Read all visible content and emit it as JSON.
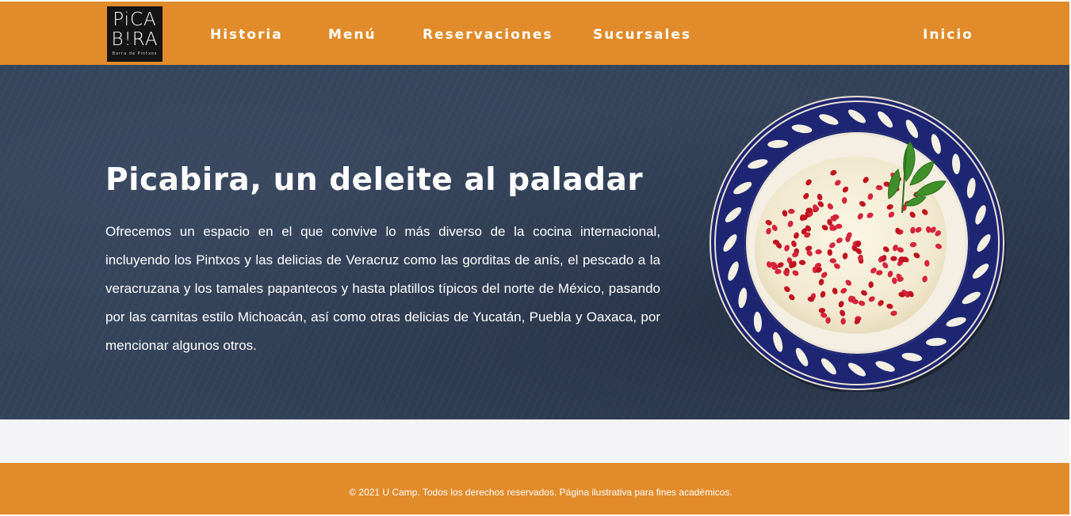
{
  "brand": {
    "logo_line1": "PiCA",
    "logo_line2": "B!RA",
    "logo_tagline": "Barra de Pintxos"
  },
  "nav": {
    "items": [
      {
        "label": "Historia"
      },
      {
        "label": "Menú"
      },
      {
        "label": "Reservaciones"
      },
      {
        "label": "Sucursales"
      }
    ],
    "home_label": "Inicio"
  },
  "hero": {
    "title": "Picabira, un deleite al paladar",
    "text": "Ofrecemos un espacio en el que convive lo más diverso de la cocina internacional, incluyendo los Pintxos y las delicias de Veracruz como las gorditas de anís, el pescado a la veracruzana y los tamales papantecos y hasta platillos típicos del norte de México, pasando por las carnitas estilo Michoacán, así como otras delicias de Yucatán, Puebla y Oaxaca, por mencionar algunos otros."
  },
  "footer": {
    "text": "© 2021 U Camp. Todos los derechos reservados. Página ilustrativa para fines académicos."
  },
  "colors": {
    "accent_orange": "#e28b2a",
    "hero_background": "#34435a",
    "plate_blue": "#1e2673"
  },
  "icons": {
    "hero_image": "chiles-en-nogada-plate-image"
  }
}
